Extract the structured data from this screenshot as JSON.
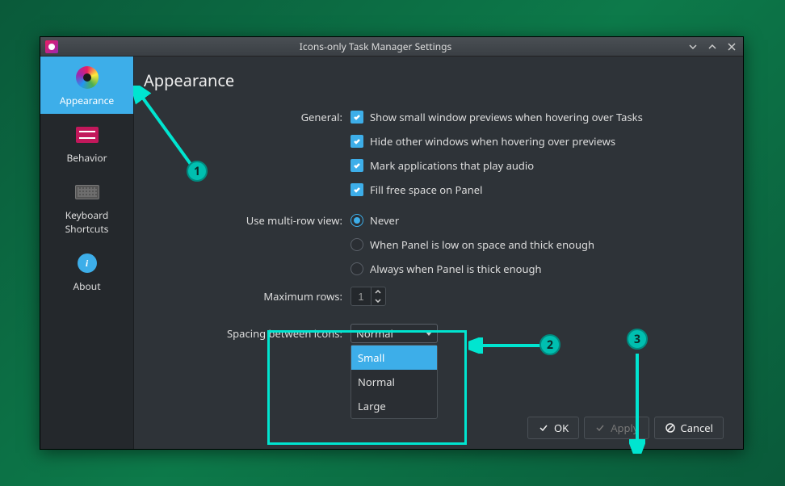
{
  "window": {
    "title": "Icons-only Task Manager Settings"
  },
  "sidebar": {
    "items": [
      {
        "label": "Appearance"
      },
      {
        "label": "Behavior"
      },
      {
        "label_line1": "Keyboard",
        "label_line2": "Shortcuts"
      },
      {
        "label": "About"
      }
    ]
  },
  "page": {
    "title": "Appearance",
    "general_label": "General:",
    "checks": [
      "Show small window previews when hovering over Tasks",
      "Hide other windows when hovering over previews",
      "Mark applications that play audio",
      "Fill free space on Panel"
    ],
    "multirow_label": "Use multi-row view:",
    "radios": [
      "Never",
      "When Panel is low on space and thick enough",
      "Always when Panel is thick enough"
    ],
    "maxrows_label": "Maximum rows:",
    "maxrows_value": "1",
    "spacing_label": "Spacing between icons:",
    "spacing_value": "Normal",
    "spacing_options": [
      "Small",
      "Normal",
      "Large"
    ]
  },
  "buttons": {
    "ok": "OK",
    "apply": "Apply",
    "cancel": "Cancel"
  },
  "annotations": {
    "c1": "1",
    "c2": "2",
    "c3": "3"
  }
}
